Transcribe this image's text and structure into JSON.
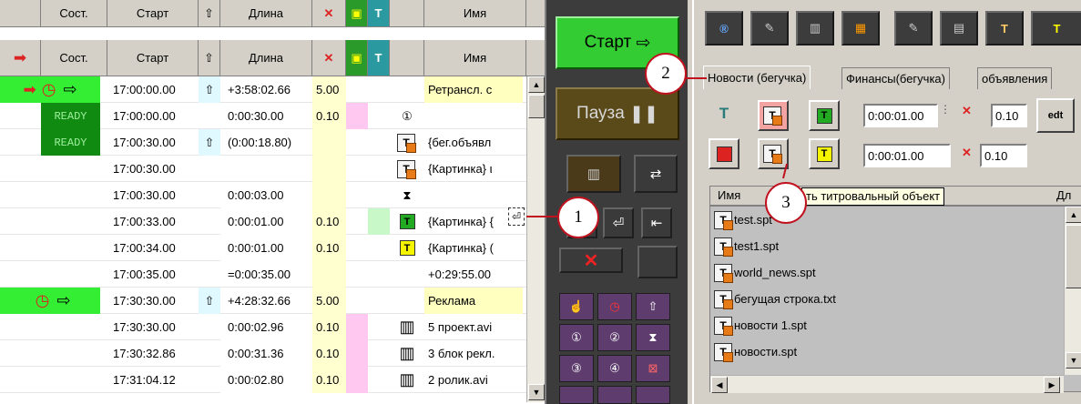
{
  "playlist": {
    "header": {
      "state": "Сост.",
      "start": "Старт",
      "length": "Длина",
      "name": "Имя"
    },
    "rows": [
      {
        "state": "icons",
        "start": "17:00:00.00",
        "arrow": "up",
        "length": "+3:58:02.66",
        "trans": "5.00",
        "type": "",
        "name": "Ретрансл. с",
        "hl": "live"
      },
      {
        "state": "READY",
        "start": "17:00:00.00",
        "arrow": "",
        "length": "0:00:30.00",
        "trans": "0.10",
        "type": "group-1",
        "name": "",
        "hl": ""
      },
      {
        "state": "READY",
        "start": "17:00:30.00",
        "arrow": "up",
        "length": "(0:00:18.80)",
        "trans": "",
        "type": "title",
        "name": "{бег.объявл",
        "hl": ""
      },
      {
        "state": "",
        "start": "17:00:30.00",
        "arrow": "",
        "length": "",
        "trans": "",
        "type": "title",
        "name": "{Картинка} ι",
        "hl": ""
      },
      {
        "state": "",
        "start": "17:00:30.00",
        "arrow": "",
        "length": "0:00:03.00",
        "trans": "",
        "type": "hourglass",
        "name": "",
        "hl": ""
      },
      {
        "state": "",
        "start": "17:00:33.00",
        "arrow": "",
        "length": "0:00:01.00",
        "trans": "0.10",
        "type": "t-green",
        "name": "{Картинка} {",
        "hl": "green"
      },
      {
        "state": "",
        "start": "17:00:34.00",
        "arrow": "",
        "length": "0:00:01.00",
        "trans": "0.10",
        "type": "t-yellow",
        "name": "{Картинка} (",
        "hl": ""
      },
      {
        "state": "",
        "start": "17:00:35.00",
        "arrow": "",
        "length": "=0:00:35.00",
        "trans": "",
        "type": "",
        "name": "+0:29:55.00",
        "hl": ""
      },
      {
        "state": "icons",
        "start": "17:30:30.00",
        "arrow": "up",
        "length": "+4:28:32.66",
        "trans": "5.00",
        "type": "",
        "name": "Реклама",
        "hl": "ad"
      },
      {
        "state": "",
        "start": "17:30:30.00",
        "arrow": "",
        "length": "0:00:02.96",
        "trans": "0.10",
        "type": "film",
        "name": "5 проект.avi",
        "hl": ""
      },
      {
        "state": "",
        "start": "17:30:32.86",
        "arrow": "",
        "length": "0:00:31.36",
        "trans": "0.10",
        "type": "film",
        "name": "3 блок рекл.",
        "hl": ""
      },
      {
        "state": "",
        "start": "17:31:04.12",
        "arrow": "",
        "length": "0:00:02.80",
        "trans": "0.10",
        "type": "film",
        "name": "2 ролик.avi",
        "hl": ""
      }
    ]
  },
  "control": {
    "start_label": "Старт",
    "pause_label": "Пауза",
    "start_color": "#33cc33",
    "pause_color": "#5a4a1a"
  },
  "right": {
    "tabs": [
      "Новости (бегучка)",
      "Финансы(бегучка)",
      "объявления"
    ],
    "field1": "0:00:01.00",
    "field1b": "0.10",
    "field2": "0:00:01.00",
    "field2b": "0.10",
    "list_header_name": "Имя",
    "list_header_dur": "Дл",
    "tooltip": "ть титровальный объект",
    "files": [
      "test.spt",
      "test1.spt",
      "world_news.spt",
      "бегущая строка.txt",
      "новости 1.spt",
      "новости.spt"
    ]
  },
  "callouts": [
    "1",
    "2",
    "3"
  ]
}
